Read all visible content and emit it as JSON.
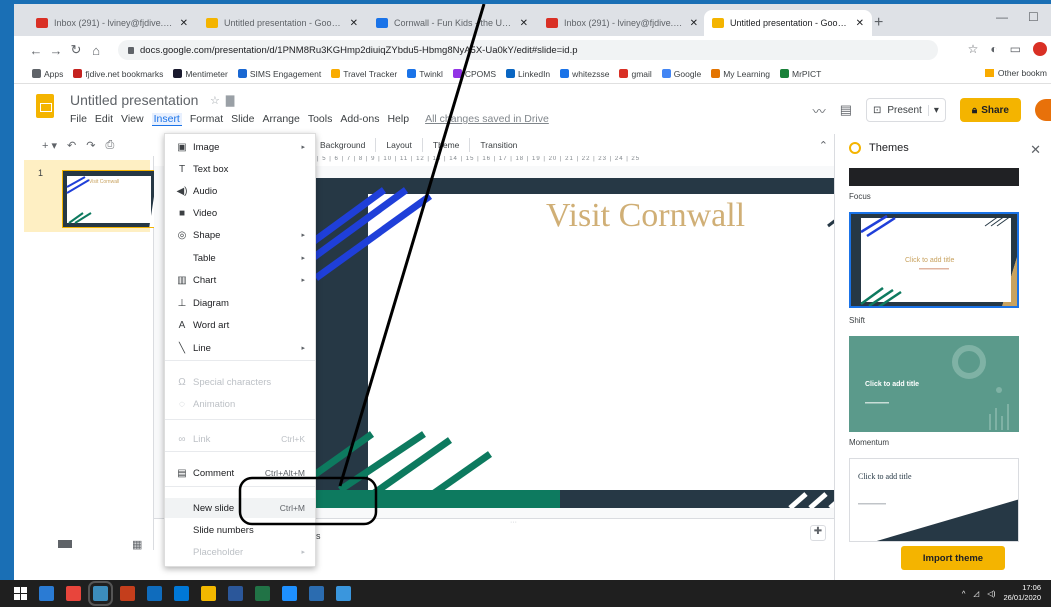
{
  "browser": {
    "tabs": [
      {
        "title": "Inbox (291) - lviney@fjdive.net",
        "favicon_color": "#d93025"
      },
      {
        "title": "Untitled presentation - Google S",
        "favicon_color": "#f4b400"
      },
      {
        "title": "Cornwall - Fun Kids - the UK's ch",
        "favicon_color": "#1a73e8"
      },
      {
        "title": "Inbox (291) - lviney@fjdive.net",
        "favicon_color": "#d93025"
      },
      {
        "title": "Untitled presentation - Google S",
        "favicon_color": "#f4b400",
        "active": true
      }
    ],
    "url": "docs.google.com/presentation/d/1PNM8Ru3KGHmp2diuiqZYbdu5-Hbmg8NyA5X-Ua0kY/edit#slide=id.p",
    "bookmarks": [
      {
        "label": "Apps",
        "color": "#5f6368"
      },
      {
        "label": "fjdive.net bookmarks",
        "color": "#c5221f"
      },
      {
        "label": "Mentimeter",
        "color": "#1a1a2e"
      },
      {
        "label": "SIMS Engagement",
        "color": "#1967d2"
      },
      {
        "label": "Travel Tracker",
        "color": "#f9ab00"
      },
      {
        "label": "Twinkl",
        "color": "#1a73e8"
      },
      {
        "label": "CPOMS",
        "color": "#9334e6"
      },
      {
        "label": "LinkedIn",
        "color": "#0a66c2"
      },
      {
        "label": "whitezsse",
        "color": "#1a73e8"
      },
      {
        "label": "gmail",
        "color": "#d93025"
      },
      {
        "label": "Google",
        "color": "#4285f4"
      },
      {
        "label": "My Learning",
        "color": "#e37400"
      },
      {
        "label": "MrPICT",
        "color": "#188038"
      }
    ],
    "other_bookmarks": "Other bookm"
  },
  "app": {
    "doc_title": "Untitled presentation",
    "menus": [
      "File",
      "Edit",
      "View",
      "Insert",
      "Format",
      "Slide",
      "Arrange",
      "Tools",
      "Add-ons",
      "Help"
    ],
    "open_menu": "Insert",
    "save_status": "All changes saved in Drive",
    "present_label": "Present",
    "share_label": "Share",
    "toolbar": {
      "background": "Background",
      "layout": "Layout",
      "theme": "Theme",
      "transition": "Transition"
    },
    "ruler": "4 | 5 | 6 | 7 | 8 | 9 | 10 | 11 | 12 | 13 | 14 | 15 | 16 | 17 | 18 | 19 | 20 | 21 | 22 | 23 | 24 | 25",
    "slide_number": "1",
    "thumb_title": "Visit Cornwall",
    "notes_fragment": "s"
  },
  "insert_menu": {
    "items": [
      {
        "label": "Image",
        "icon": "image-icon",
        "glyph": "▣",
        "submenu": true
      },
      {
        "label": "Text box",
        "icon": "textbox-icon",
        "glyph": "T"
      },
      {
        "label": "Audio",
        "icon": "audio-icon",
        "glyph": "◀)"
      },
      {
        "label": "Video",
        "icon": "video-icon",
        "glyph": "■"
      },
      {
        "label": "Shape",
        "icon": "shape-icon",
        "glyph": "◎",
        "submenu": true
      },
      {
        "label": "Table",
        "submenu": true
      },
      {
        "label": "Chart",
        "icon": "chart-icon",
        "glyph": "▥",
        "submenu": true
      },
      {
        "label": "Diagram",
        "icon": "diagram-icon",
        "glyph": "⊥"
      },
      {
        "label": "Word art",
        "icon": "wordart-icon",
        "glyph": "A"
      },
      {
        "label": "Line",
        "icon": "line-icon",
        "glyph": "╲",
        "submenu": true
      },
      {
        "label": "Special characters",
        "icon": "omega-icon",
        "glyph": "Ω",
        "disabled": true
      },
      {
        "label": "Animation",
        "icon": "animation-icon",
        "glyph": "◌",
        "disabled": true
      },
      {
        "label": "Link",
        "icon": "link-icon",
        "glyph": "∞",
        "shortcut": "Ctrl+K",
        "disabled": true
      },
      {
        "label": "Comment",
        "icon": "comment-icon",
        "glyph": "▤",
        "shortcut": "Ctrl+Alt+M"
      },
      {
        "label": "New slide",
        "shortcut": "Ctrl+M",
        "highlighted": true
      },
      {
        "label": "Slide numbers"
      },
      {
        "label": "Placeholder",
        "submenu": true,
        "disabled": true
      }
    ]
  },
  "themes_panel": {
    "title": "Themes",
    "themes": [
      {
        "name": "Focus",
        "card_title": ""
      },
      {
        "name": "Shift",
        "card_title": "Click to add title"
      },
      {
        "name": "Momentum",
        "card_title": "Click to add title"
      },
      {
        "name": "",
        "card_title": "Click to add title"
      }
    ],
    "import_label": "Import theme"
  },
  "taskbar": {
    "time": "17:06",
    "date": "26/01/2020",
    "apps": [
      "#2a7bd4",
      "#e8453c",
      "#3c8dbc",
      "#c43e1c",
      "#0f6cbd",
      "#0078d7",
      "#f3b800",
      "#2b579a",
      "#217346",
      "#1e90ff",
      "#2b6cb0",
      "#3a96dd"
    ]
  },
  "colors": {
    "accent": "#f4b400",
    "slide_navy": "#263845",
    "slide_blue": "#1f3fd9",
    "slide_green": "#0d7a5f",
    "slide_tan": "#c8a25f",
    "momentum_teal": "#5b9a8b",
    "annotation": "#000000"
  }
}
